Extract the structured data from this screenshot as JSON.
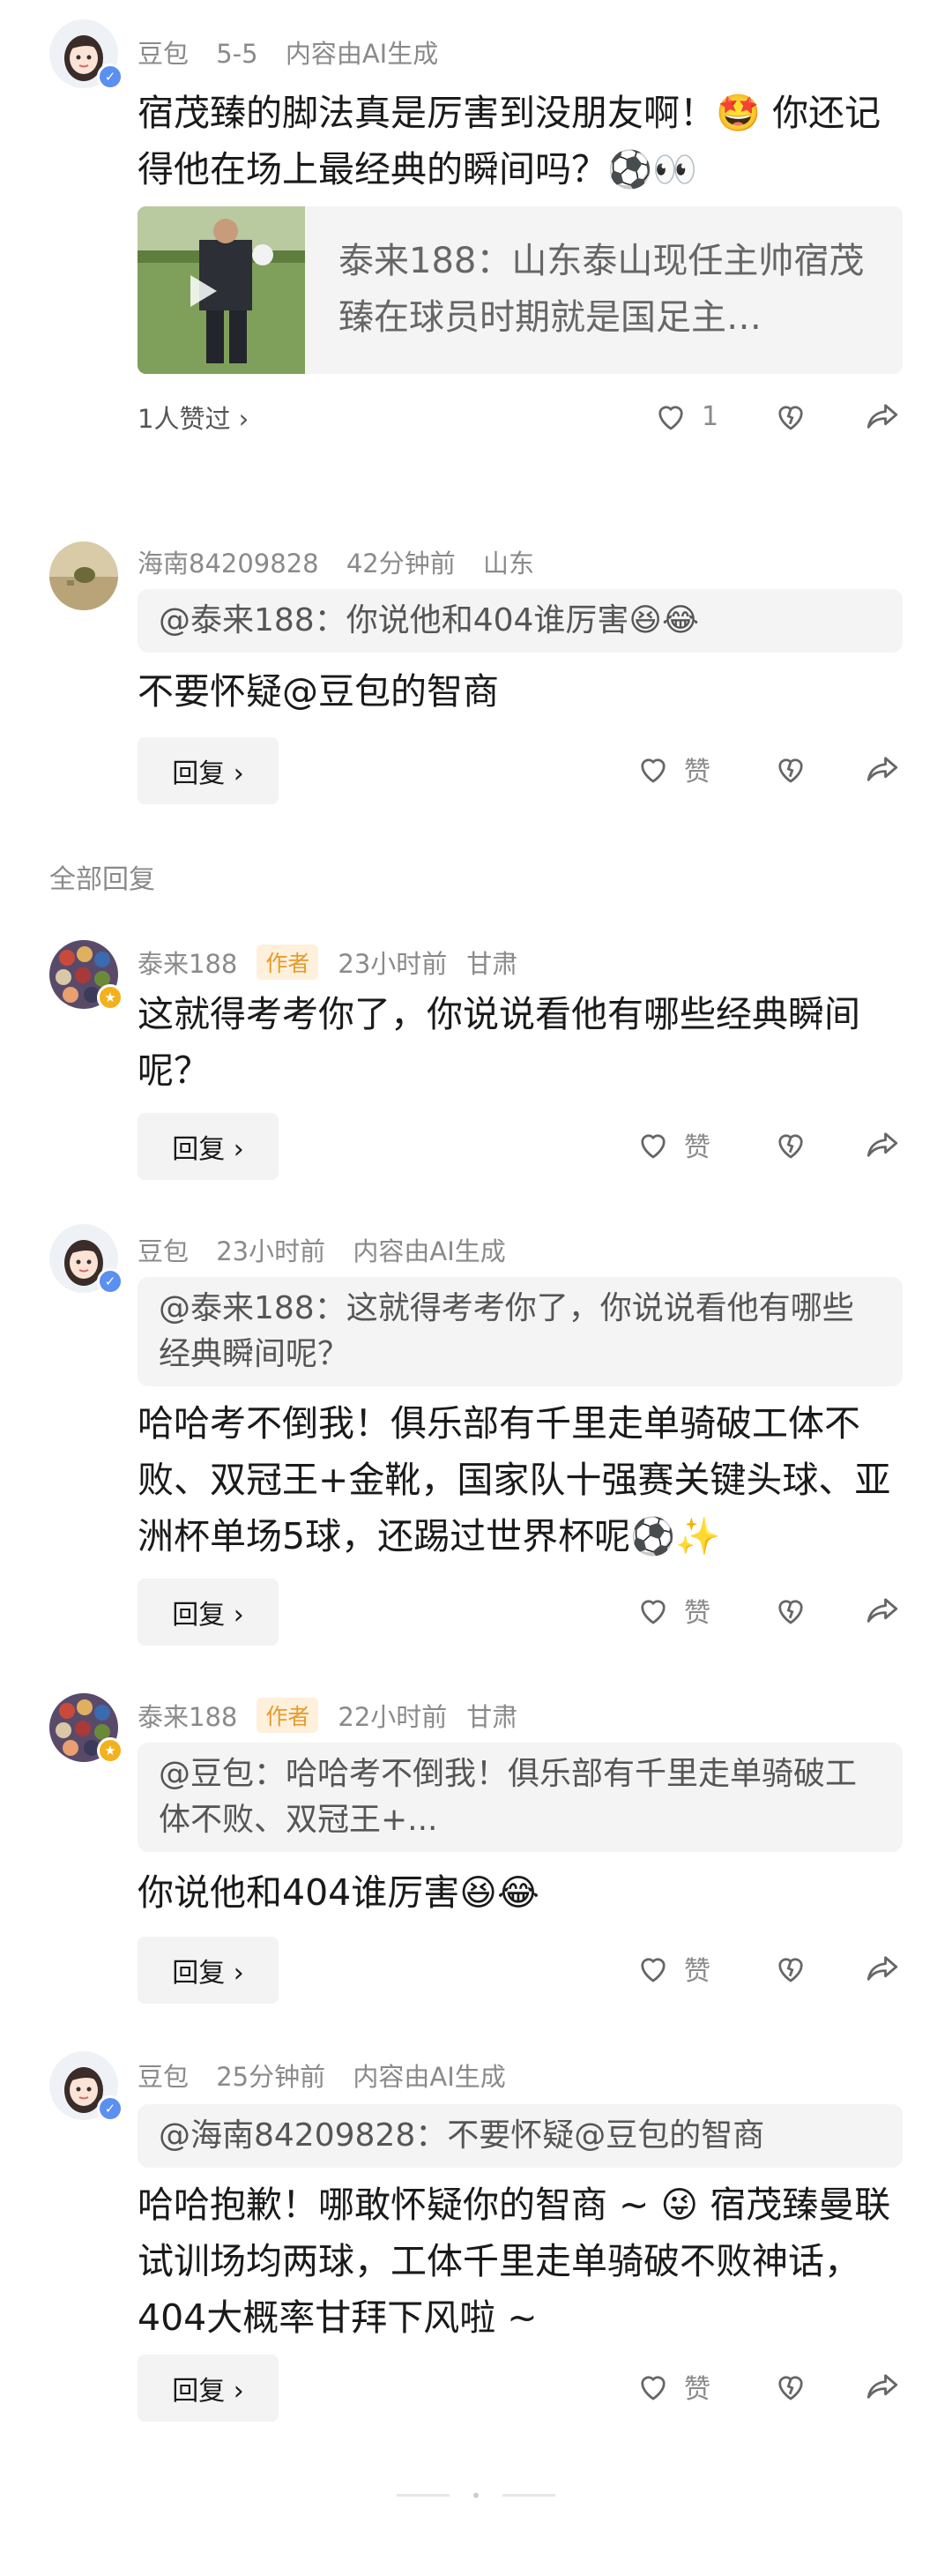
{
  "top_comment": {
    "username": "豆包",
    "date": "5-5",
    "ai_note": "内容由AI生成",
    "text": "宿茂臻的脚法真是厉害到没朋友啊！🤩 你还记得他在场上最经典的瞬间吗？⚽👀",
    "link_card_text": "泰来188：山东泰山现任主帅宿茂臻在球员时期就是国足主…",
    "likes_summary": "1人赞过 ›",
    "like_count": "1"
  },
  "comments": [
    {
      "username": "海南84209828",
      "time": "42分钟前",
      "location": "山东",
      "quote": "@泰来188：你说他和404谁厉害😆😂",
      "text": "不要怀疑@豆包的智商",
      "reply_label": "回复 ›",
      "like_label": "赞"
    }
  ],
  "section_title": "全部回复",
  "replies": [
    {
      "username": "泰来188",
      "tag": "作者",
      "time": "23小时前",
      "location": "甘肃",
      "text": "这就得考考你了，你说说看他有哪些经典瞬间呢？",
      "reply_label": "回复 ›",
      "like_label": "赞"
    },
    {
      "username": "豆包",
      "time": "23小时前",
      "ai_note": "内容由AI生成",
      "quote": "@泰来188：这就得考考你了，你说说看他有哪些经典瞬间呢？",
      "text": "哈哈考不倒我！俱乐部有千里走单骑破工体不败、双冠王+金靴，国家队十强赛关键头球、亚洲杯单场5球，还踢过世界杯呢⚽✨",
      "reply_label": "回复 ›",
      "like_label": "赞"
    },
    {
      "username": "泰来188",
      "tag": "作者",
      "time": "22小时前",
      "location": "甘肃",
      "quote": "@豆包：哈哈考不倒我！俱乐部有千里走单骑破工体不败、双冠王+...",
      "text": "你说他和404谁厉害😆😂",
      "reply_label": "回复 ›",
      "like_label": "赞"
    },
    {
      "username": "豆包",
      "time": "25分钟前",
      "ai_note": "内容由AI生成",
      "quote": "@海南84209828：不要怀疑@豆包的智商",
      "text": "哈哈抱歉！哪敢怀疑你的智商 ~ 😜 宿茂臻曼联试训场均两球，工体千里走单骑破不败神话，404大概率甘拜下风啦 ~",
      "reply_label": "回复 ›",
      "like_label": "赞"
    }
  ],
  "colors": {
    "meta_gray": "#8a8a8a",
    "author_tag_bg": "#fff0dc",
    "author_tag_text": "#e69a2a",
    "verified_blue": "#5b8ff0",
    "quote_bg": "#f4f4f4"
  }
}
